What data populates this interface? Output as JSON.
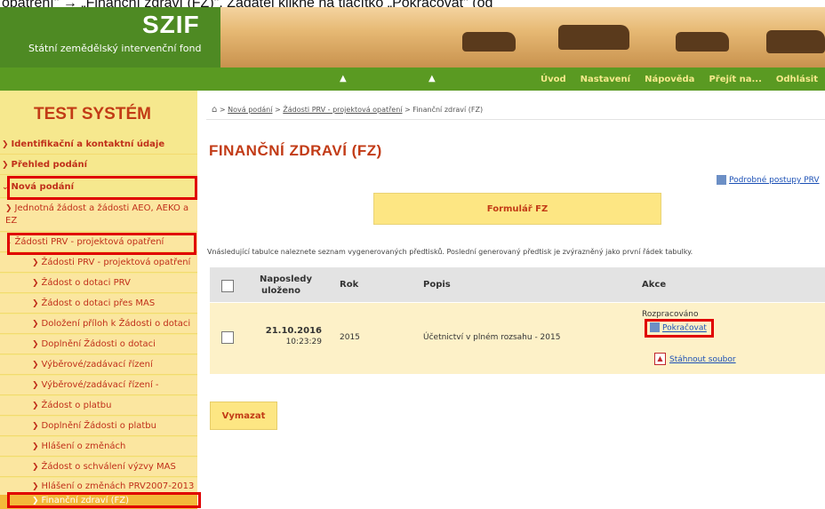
{
  "caption": "opatření\" → „Finanční zdraví (FZ)\". Žadatel klikne na tlačítko „Pokračovat\" (od",
  "header": {
    "logo": "SZIF",
    "subtitle": "Státní zemědělský intervenční fond"
  },
  "topnav": {
    "items": [
      "Úvod",
      "Nastavení",
      "Nápověda",
      "Přejít na...",
      "Odhlásit"
    ]
  },
  "sidebar": {
    "title": "TEST SYSTÉM",
    "items": [
      {
        "label": "Identifikační a kontaktní údaje"
      },
      {
        "label": "Přehled podání"
      },
      {
        "label": "Nová podání"
      },
      {
        "label": "Jednotná žádost a žádosti AEO, AEKO a EZ"
      },
      {
        "label": "Žádosti PRV - projektová opatření"
      },
      {
        "label": "Žádosti PRV - projektová opatření"
      },
      {
        "label": "Žádost o dotaci PRV"
      },
      {
        "label": "Žádost o dotaci přes MAS"
      },
      {
        "label": "Doložení příloh k Žádosti o dotaci"
      },
      {
        "label": "Doplnění Žádosti o dotaci"
      },
      {
        "label": "Výběrové/zadávací řízení"
      },
      {
        "label": "Výběrové/zadávací řízení - doplnění"
      },
      {
        "label": "Žádost o platbu"
      },
      {
        "label": "Doplnění Žádosti o platbu"
      },
      {
        "label": "Hlášení o změnách"
      },
      {
        "label": "Žádost o schválení výzvy MAS"
      },
      {
        "label": "Hlášení o změnách PRV2007-2013"
      },
      {
        "label": "Finanční zdraví (FZ)"
      }
    ]
  },
  "breadcrumb": {
    "link1": "Nová podání",
    "link2": "Žádosti PRV - projektová opatření",
    "current": "Finanční zdraví (FZ)"
  },
  "main": {
    "title": "FINANČNÍ ZDRAVÍ (FZ)",
    "detail_link": "Podrobné postupy PRV",
    "form_button": "Formulář FZ",
    "info": "Vnásledující tabulce naleznete seznam vygenerovaných předtisků. Poslední generovaný předtisk je zvýrazněný jako první řádek tabulky.",
    "delete_button": "Vymazat"
  },
  "table": {
    "headers": {
      "saved": "Naposledy uloženo",
      "year": "Rok",
      "desc": "Popis",
      "actions": "Akce"
    },
    "rows": [
      {
        "date": "21.10.2016",
        "time": "10:23:29",
        "year": "2015",
        "desc": "Účetnictví v plném rozsahu - 2015",
        "status": "Rozpracováno",
        "continue": "Pokračovat",
        "download": "Stáhnout soubor"
      }
    ]
  },
  "colors": {
    "accent": "#c23b16",
    "nav": "#5a9a22",
    "sidebar": "#f6e88e",
    "highlight": "#e00000"
  }
}
